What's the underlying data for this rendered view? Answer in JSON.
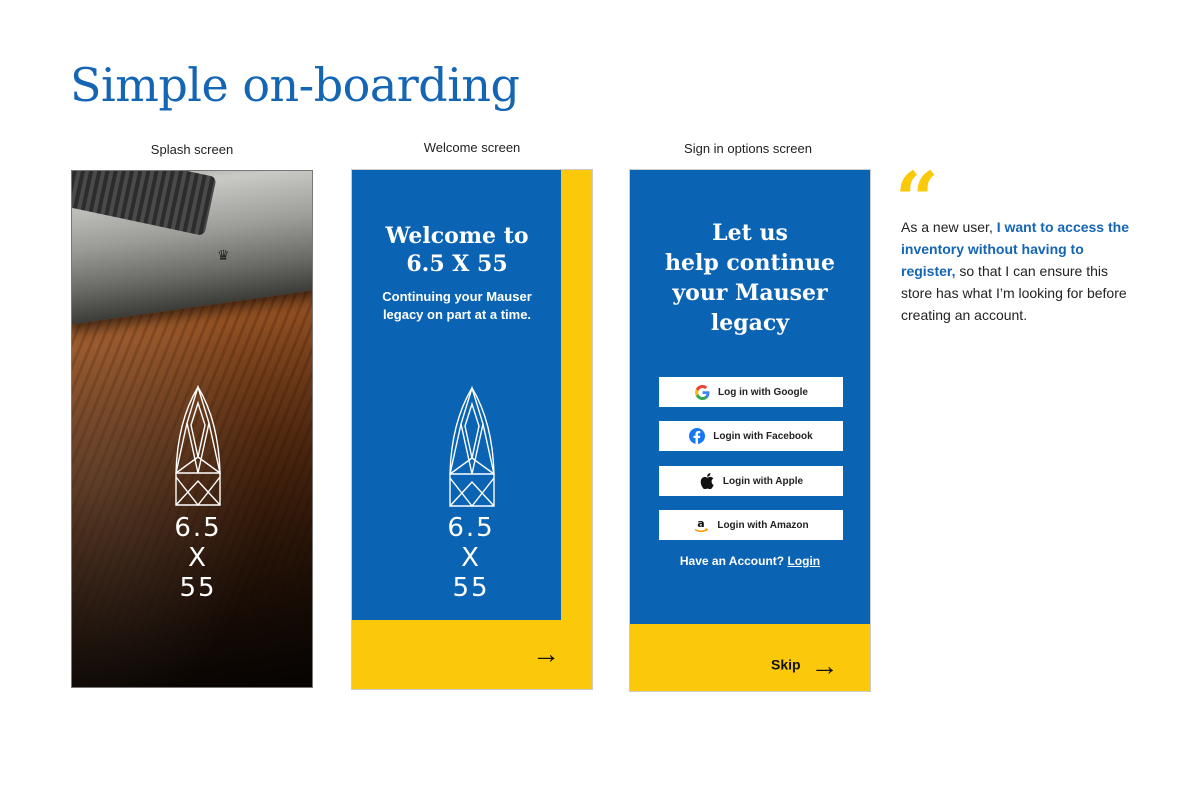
{
  "page_title": "Simple on-boarding",
  "screens": {
    "splash": {
      "label": "Splash screen",
      "logo_lines": [
        "6.5",
        "X",
        "55"
      ]
    },
    "welcome": {
      "label": "Welcome screen",
      "title_line1": "Welcome to",
      "title_line2": "6.5 X 55",
      "subtitle_line1": "Continuing your Mauser",
      "subtitle_line2": "legacy on part at a time.",
      "logo_lines": [
        "6.5",
        "X",
        "55"
      ],
      "next_arrow": "→"
    },
    "signin": {
      "label": "Sign in options screen",
      "title_lines": [
        "Let us",
        "help continue",
        "your Mauser",
        "legacy"
      ],
      "buttons": [
        {
          "label": "Log in with Google",
          "icon": "google-icon"
        },
        {
          "label": "Login with Facebook",
          "icon": "facebook-icon"
        },
        {
          "label": "Login with Apple",
          "icon": "apple-icon"
        },
        {
          "label": "Login with Amazon",
          "icon": "amazon-icon"
        }
      ],
      "have_account_text": "Have an Account?",
      "login_link": "Login",
      "skip_label": "Skip",
      "skip_arrow": "→"
    }
  },
  "quote": {
    "mark": "“",
    "text_before": "As a new user, ",
    "highlight": "I want to access the inventory without having to register,",
    "text_after": " so that I can ensure this store has what I’m looking for before creating an account."
  },
  "colors": {
    "brand_blue": "#0a63b3",
    "title_blue": "#1565b5",
    "accent_yellow": "#fbc90a"
  }
}
